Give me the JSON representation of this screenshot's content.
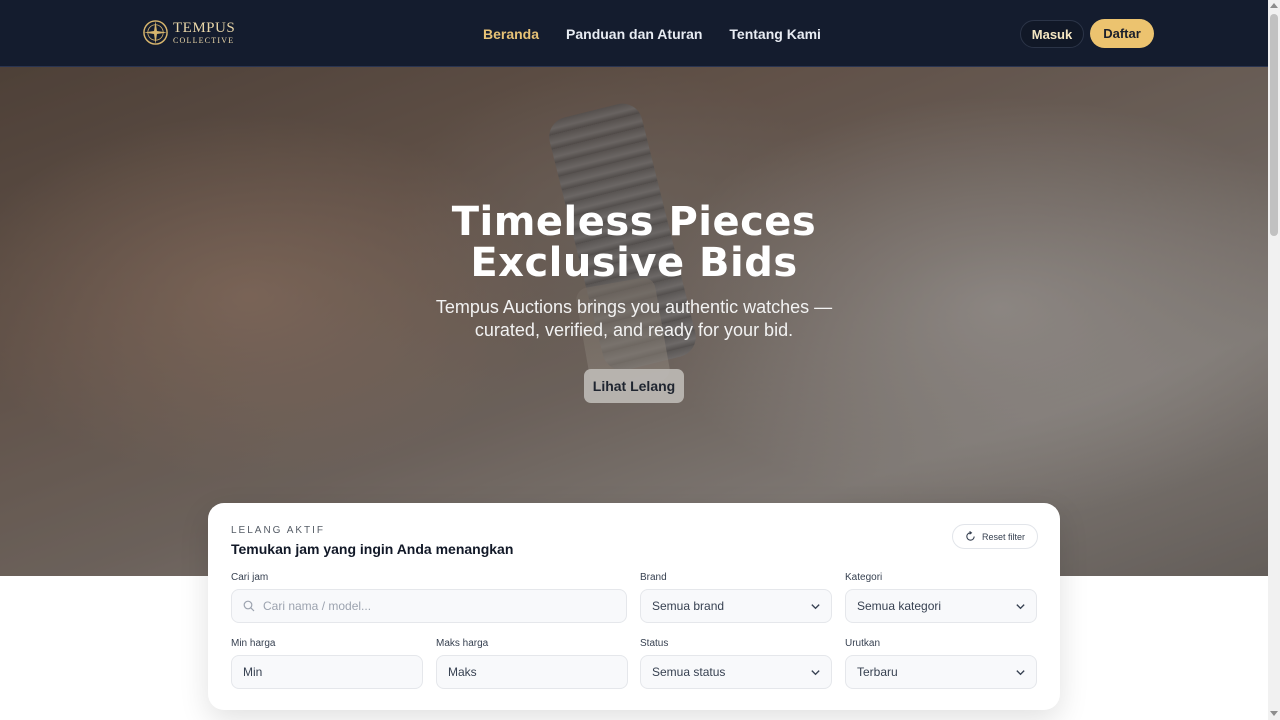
{
  "brand": {
    "name": "TEMPUS",
    "subtitle": "COLLECTIVE",
    "logo_icon": "compass-icon"
  },
  "nav": {
    "links": [
      {
        "label": "Beranda",
        "active": true
      },
      {
        "label": "Panduan dan Aturan",
        "active": false
      },
      {
        "label": "Tentang Kami",
        "active": false
      }
    ],
    "login_label": "Masuk",
    "register_label": "Daftar"
  },
  "hero": {
    "title_line1": "Timeless Pieces",
    "title_line2": "Exclusive Bids",
    "subtitle": "Tempus Auctions brings you authentic watches — curated, verified, and ready for your bid.",
    "cta_label": "Lihat Lelang"
  },
  "filter": {
    "eyebrow": "LELANG AKTIF",
    "title": "Temukan jam yang ingin Anda menangkan",
    "reset_label": "Reset filter",
    "search": {
      "label": "Cari jam",
      "placeholder": "Cari nama / model..."
    },
    "brand": {
      "label": "Brand",
      "value": "Semua brand"
    },
    "category": {
      "label": "Kategori",
      "value": "Semua kategori"
    },
    "min_price": {
      "label": "Min harga",
      "placeholder": "Min"
    },
    "max_price": {
      "label": "Maks harga",
      "placeholder": "Maks"
    },
    "status": {
      "label": "Status",
      "value": "Semua status"
    },
    "sort": {
      "label": "Urutkan",
      "value": "Terbaru"
    }
  },
  "colors": {
    "navbar_bg": "#141c2e",
    "accent_gold": "#ecc36f",
    "active_link": "#e7c276"
  }
}
